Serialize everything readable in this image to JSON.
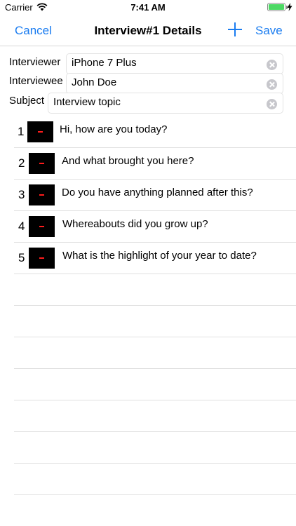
{
  "status_bar": {
    "carrier": "Carrier",
    "time": "7:41 AM"
  },
  "nav": {
    "cancel": "Cancel",
    "title": "Interview#1 Details",
    "save": "Save",
    "accent_color": "#1a7cf0"
  },
  "form": {
    "interviewer": {
      "label": "Interviewer",
      "value": "iPhone 7 Plus"
    },
    "interviewee": {
      "label": "Interviewee",
      "value": "John Doe"
    },
    "subject": {
      "label": "Subject",
      "value": "Interview topic"
    }
  },
  "questions": [
    {
      "number": "1",
      "text": "Hi, how are you today?"
    },
    {
      "number": "2",
      "text": "And what brought you here?"
    },
    {
      "number": "3",
      "text": "Do you have anything planned after this?"
    },
    {
      "number": "4",
      "text": "Whereabouts did you grow up?"
    },
    {
      "number": "5",
      "text": "What is the highlight of your year to date?"
    }
  ]
}
